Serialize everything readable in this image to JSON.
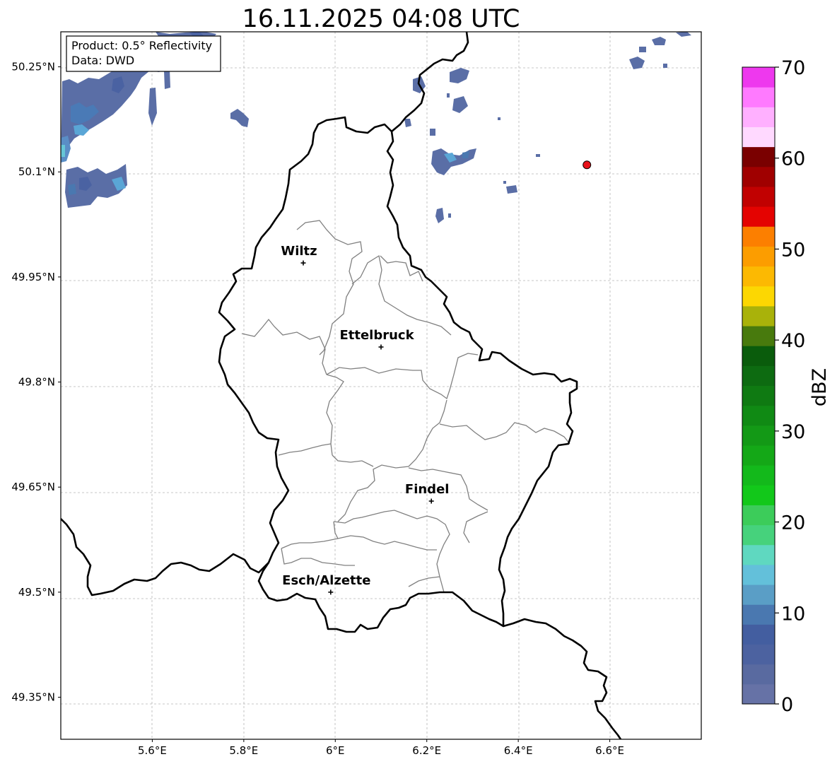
{
  "title": "16.11.2025 04:08 UTC",
  "info_box": {
    "line1": "Product: 0.5° Reflectivity",
    "line2": "Data: DWD"
  },
  "map": {
    "lon_range": [
      5.4,
      6.8
    ],
    "lat_range": [
      49.29,
      50.3
    ],
    "lon_ticks": [
      "5.6°E",
      "5.8°E",
      "6°E",
      "6.2°E",
      "6.4°E",
      "6.6°E"
    ],
    "lat_ticks": [
      "50.25°N",
      "50.1°N",
      "49.95°N",
      "49.8°N",
      "49.65°N",
      "49.5°N",
      "49.35°N"
    ],
    "gridlines": true
  },
  "cities": [
    {
      "name": "Wiltz",
      "lon": 5.93,
      "lat": 49.97
    },
    {
      "name": "Ettelbruck",
      "lon": 6.1,
      "lat": 49.85
    },
    {
      "name": "Findel",
      "lon": 6.21,
      "lat": 49.63
    },
    {
      "name": "Esch/Alzette",
      "lon": 5.99,
      "lat": 49.5
    }
  ],
  "radar_site": {
    "lon": 6.55,
    "lat": 50.11,
    "color": "#e8121b"
  },
  "colorbar": {
    "label": "dBZ",
    "min": 0,
    "max": 70,
    "ticks": [
      "0",
      "10",
      "20",
      "30",
      "40",
      "50",
      "60",
      "70"
    ],
    "colors": [
      "#6672a6",
      "#596aa0",
      "#4c62a0",
      "#435ea0",
      "#4a78b0",
      "#5a9ec6",
      "#63c0da",
      "#5fd8c0",
      "#46d27c",
      "#3ccc5a",
      "#12c81a",
      "#13b91b",
      "#14a817",
      "#139916",
      "#108a14",
      "#0f7a12",
      "#0d6b11",
      "#0a5c0c",
      "#487a0d",
      "#a9b20a",
      "#fcd702",
      "#fcb902",
      "#fc9d00",
      "#fc7f00",
      "#e40301",
      "#c10101",
      "#a00000",
      "#7a0000",
      "#ffd9ff",
      "#ffb0ff",
      "#ff7aff",
      "#ee38ee"
    ]
  }
}
